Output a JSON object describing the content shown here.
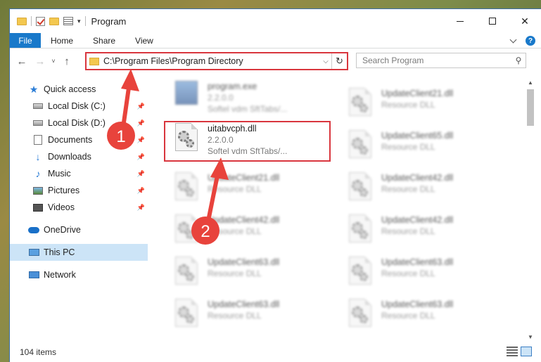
{
  "window": {
    "title": "Program",
    "minimize_label": "Minimize",
    "maximize_label": "Maximize",
    "close_glyph": "✕"
  },
  "ribbon": {
    "tabs": [
      "File",
      "Home",
      "Share",
      "View"
    ],
    "help_glyph": "?"
  },
  "nav": {
    "back_glyph": "←",
    "forward_glyph": "→",
    "recent_glyph": "˅",
    "up_glyph": "↑",
    "address": "C:\\Program Files\\Program Directory",
    "dropdown_glyph": "⌵",
    "refresh_glyph": "↻",
    "search_placeholder": "Search Program",
    "search_glyph": "⚲"
  },
  "sidebar": {
    "items": [
      {
        "label": "Quick access",
        "icon": "star-icon",
        "pinned": false
      },
      {
        "label": "Local Disk (C:)",
        "icon": "drive-icon",
        "pinned": true
      },
      {
        "label": "Local Disk (D:)",
        "icon": "drive-icon",
        "pinned": true
      },
      {
        "label": "Documents",
        "icon": "documents-icon",
        "pinned": true
      },
      {
        "label": "Downloads",
        "icon": "downloads-icon",
        "pinned": true
      },
      {
        "label": "Music",
        "icon": "music-icon",
        "pinned": true
      },
      {
        "label": "Pictures",
        "icon": "pictures-icon",
        "pinned": true
      },
      {
        "label": "Videos",
        "icon": "videos-icon",
        "pinned": true
      },
      {
        "label": "OneDrive",
        "icon": "onedrive-icon",
        "pinned": false
      },
      {
        "label": "This PC",
        "icon": "this-pc-icon",
        "pinned": false,
        "selected": true
      },
      {
        "label": "Network",
        "icon": "network-icon",
        "pinned": false
      }
    ],
    "pin_glyph": "📌"
  },
  "files": {
    "left_column": [
      {
        "name": "program.exe",
        "line2": "2.2.0.0",
        "line3": "Softel vdm SftTabs/...",
        "type": "exe",
        "blurred": true
      },
      {
        "name": "uitabvcph.dll",
        "line2": "2.2.0.0",
        "line3": "Softel vdm SftTabs/...",
        "type": "dll",
        "blurred": false,
        "highlighted": true
      },
      {
        "name": "UpdateClient21.dll",
        "line2": "Resource DLL",
        "line3": "",
        "type": "dll",
        "blurred": true
      },
      {
        "name": "UpdateClient42.dll",
        "line2": "Resource DLL",
        "line3": "",
        "type": "dll",
        "blurred": true
      },
      {
        "name": "UpdateClient63.dll",
        "line2": "Resource DLL",
        "line3": "",
        "type": "dll",
        "blurred": true
      },
      {
        "name": "UpdateClient63.dll",
        "line2": "Resource DLL",
        "line3": "",
        "type": "dll",
        "blurred": true
      }
    ],
    "right_column": [
      {
        "name": "UpdateClient21.dll",
        "line2": "Resource DLL",
        "type": "dll",
        "blurred": true
      },
      {
        "name": "UpdateClient65.dll",
        "line2": "Resource DLL",
        "type": "dll",
        "blurred": true
      },
      {
        "name": "UpdateClient42.dll",
        "line2": "Resource DLL",
        "type": "dll",
        "blurred": true
      },
      {
        "name": "UpdateClient42.dll",
        "line2": "Resource DLL",
        "type": "dll",
        "blurred": true
      },
      {
        "name": "UpdateClient63.dll",
        "line2": "Resource DLL",
        "type": "dll",
        "blurred": true
      },
      {
        "name": "UpdateClient63.dll",
        "line2": "Resource DLL",
        "type": "dll",
        "blurred": true
      }
    ]
  },
  "status": {
    "item_count": "104 items"
  },
  "annotations": {
    "step1": "1",
    "step2": "2",
    "color": "#e8433c"
  },
  "colors": {
    "accent": "#1979ca",
    "highlight_border": "#d9363e",
    "selected_bg": "#cce4f7"
  }
}
